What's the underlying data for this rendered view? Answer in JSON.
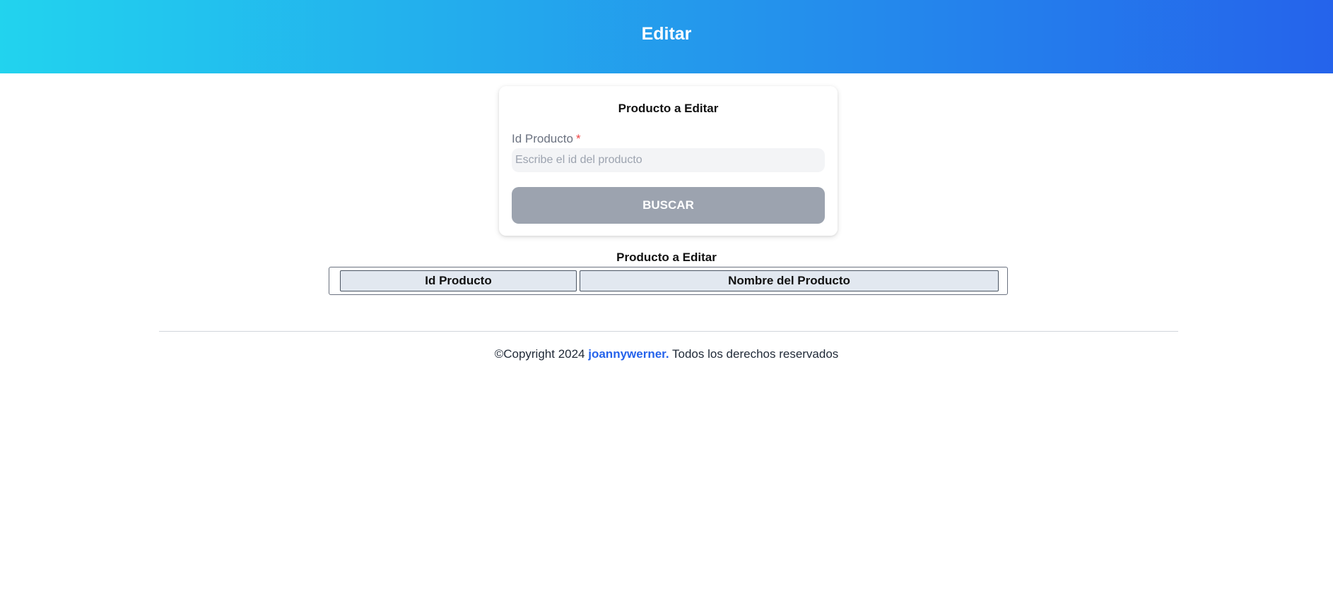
{
  "header": {
    "title": "Editar"
  },
  "search_card": {
    "title": "Producto a Editar",
    "id_label": "Id Producto",
    "required_mark": "*",
    "id_input": {
      "value": "",
      "placeholder": "Escribe el id del producto"
    },
    "search_button_label": "BUSCAR"
  },
  "result_table": {
    "caption": "Producto a Editar",
    "columns": [
      "Id Producto",
      "Nombre del Producto"
    ]
  },
  "footer": {
    "copyright_prefix": "©Copyright 2024",
    "author_link": "joannywerner.",
    "rights_text": "Todos los derechos reservados"
  },
  "colors": {
    "header_gradient_start": "#22d3ee",
    "header_gradient_end": "#2563eb",
    "button_disabled": "#9ca3af",
    "required": "#ef4444",
    "link": "#2563eb",
    "table_header_bg": "#e2e8f0"
  }
}
